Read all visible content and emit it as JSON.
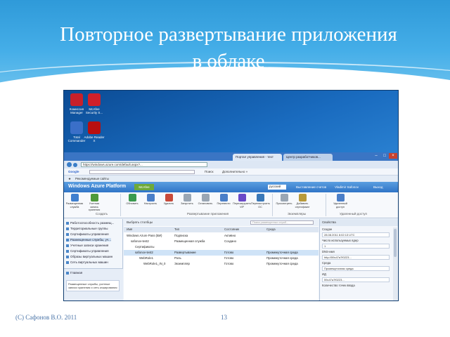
{
  "slide": {
    "title_line1": "Повторное развертывание приложения",
    "title_line2": "в облаке",
    "footer_left": "(C) Сафонов В.О. 2011",
    "page_number": "13"
  },
  "desktop": {
    "icons": [
      {
        "label": "Комиссия Manager",
        "color": "#c8202a",
        "icon": "app-red-icon"
      },
      {
        "label": "McAfee Security S...",
        "color": "#d0202a",
        "icon": "mcafee-icon"
      },
      {
        "label": "Total Commander",
        "color": "#3a6fc8",
        "icon": "floppy-icon"
      },
      {
        "label": "Adobe Reader X",
        "color": "#b80f10",
        "icon": "pdf-icon"
      }
    ]
  },
  "browser": {
    "url": "https://windows.azure.com/default.aspx?...",
    "tabs": [
      "Портал управления - теxт",
      "Центр разработчиков..."
    ],
    "google_label": "Google",
    "search_hint": "Поиск",
    "more_label": "Дополнительно »",
    "fav_item": "Рекомендуемые сайты",
    "portal_logo": "Windows Azure Platform",
    "mcafee_badge": "McAfee",
    "lang": "русский",
    "top_links": [
      "Выставление счетов",
      "Vladimir Safonov",
      "Выход"
    ]
  },
  "ribbon": {
    "buttons": [
      {
        "label": "Размещенная служба",
        "color": "#3f7fcf"
      },
      {
        "label": "Учетная запись хранения",
        "color": "#4f9a3a"
      },
      {
        "label": "Обновить",
        "color": "#3a9a4f"
      },
      {
        "label": "Настроить",
        "color": "#4a7ec8"
      },
      {
        "label": "Удалить",
        "color": "#c84a3a"
      },
      {
        "label": "Запустить",
        "color": "#9aa6b4"
      },
      {
        "label": "Остановить",
        "color": "#9aa6b4"
      },
      {
        "label": "Перевести",
        "color": "#4a7ec8"
      },
      {
        "label": "Перезагрузить VIP",
        "color": "#6a4ac8"
      },
      {
        "label": "Перенастроить ОС",
        "color": "#3a78b8"
      },
      {
        "label": "Просмотреть",
        "color": "#9aa6b4"
      },
      {
        "label": "Добавить сертификат",
        "color": "#b89a3a"
      },
      {
        "label": "Удаленный доступ",
        "color": "#4a7ec8"
      }
    ],
    "groups": [
      "Создать",
      "Развертывание приложения",
      "Экземпляры",
      "Удаленный доступ"
    ]
  },
  "nav": {
    "items": [
      "Работоспособность размещ...",
      "Территориальные группы",
      "Сертификаты управления",
      "Размещенные службы, уч...",
      "Учетные записи хранения",
      "Сертификаты управления",
      "Образы виртуальных машин",
      "Сеть виртуальных машин"
    ],
    "home_label": "Главная",
    "hint": "Размещенные службы, учетные записи хранения и сеть кэширования"
  },
  "grid": {
    "toolbar_label": "Выбрать столбцы",
    "search_placeholder": "Поиск размещенных служб...",
    "columns": [
      "Имя",
      "Тип",
      "Состояние",
      "Среда"
    ],
    "rows": [
      {
        "name": "Windows Azure Pass (ВИ)",
        "type": "Подписка",
        "status": "Активно",
        "env": ""
      },
      {
        "name": "safonov-test2",
        "type": "Размещенная служба",
        "status": "Создано",
        "env": ""
      },
      {
        "name": "Сертификаты",
        "type": "",
        "status": "",
        "env": ""
      },
      {
        "name": "safonov-test2",
        "type": "Развертывание",
        "status": "Готово",
        "env": "Промежуточная среда"
      },
      {
        "name": "WebRole1",
        "type": "Роль",
        "status": "Готово",
        "env": "Промежуточная среда"
      },
      {
        "name": "WebRole1_IN_0",
        "type": "Экземпляр",
        "status": "Готово",
        "env": "Промежуточная среда"
      }
    ]
  },
  "props": {
    "title": "Свойства",
    "fields": [
      {
        "label": "Создан",
        "value": "28.08.2011 6:02:13 UTC"
      },
      {
        "label": "Число используемых ядер",
        "value": "1"
      },
      {
        "label": "DNS-имя",
        "value": "http://59c47a7f0223..."
      },
      {
        "label": "Среда",
        "value": "Промежуточная среда"
      },
      {
        "label": "ИД",
        "value": "59c47a7f0223..."
      },
      {
        "label": "Количество точек ввода",
        "value": ""
      }
    ]
  }
}
